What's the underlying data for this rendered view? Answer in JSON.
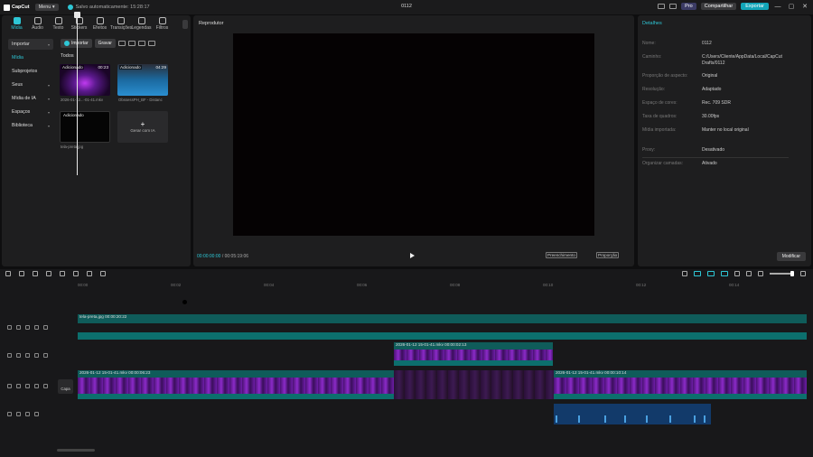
{
  "titlebar": {
    "app_name": "CapCut",
    "menu_label": "Menu",
    "autosave": "Salvo automaticamente: 15:28:17",
    "project_title": "0112",
    "pro_label": "Pro",
    "share_label": "Compartilhar",
    "export_label": "Exportar",
    "win_min": "—",
    "win_max": "▢",
    "win_close": "✕"
  },
  "tools": [
    {
      "label": "Mídia"
    },
    {
      "label": "Áudio"
    },
    {
      "label": "Texto"
    },
    {
      "label": "Stickers"
    },
    {
      "label": "Efeitos"
    },
    {
      "label": "Transições"
    },
    {
      "label": "Legendas"
    },
    {
      "label": "Filtros"
    }
  ],
  "sidenav": {
    "import": "Importar",
    "media": "Mídia",
    "subprojects": "Subprojetos",
    "yours": "Seus",
    "ai_media": "Mídia de IA",
    "spaces": "Espaços",
    "library": "Biblioteca"
  },
  "media": {
    "import_btn": "Importar",
    "record_btn": "Gravar",
    "all_label": "Todos",
    "items": [
      {
        "tag": "Adicionado",
        "duration": "00:23",
        "name": "2026-01-12...-01-41.mkv"
      },
      {
        "tag": "Adicionado",
        "duration": "04:29",
        "name": "ObssessPH_BF - Distanc"
      },
      {
        "tag": "Adicionado",
        "duration": "",
        "name": "tela-preta.jpg"
      },
      {
        "tag": "",
        "duration": "",
        "name": "Gerar com IA"
      }
    ]
  },
  "player": {
    "title": "Reprodutor",
    "current_time": "00:00:00:00",
    "total_time": "00:05:19:06",
    "fill_label": "Preenchimento",
    "ratio_label": "Proporção"
  },
  "details": {
    "title": "Detalhes",
    "rows": [
      {
        "k": "Nome:",
        "v": "0112"
      },
      {
        "k": "Caminho:",
        "v": "C:/Users/Cliente/AppData/Local/CapCut Drafts/0112"
      },
      {
        "k": "Proporção de aspecto:",
        "v": "Original"
      },
      {
        "k": "Resolução:",
        "v": "Adaptado"
      },
      {
        "k": "Espaço de cores:",
        "v": "Rec. 709 SDR"
      },
      {
        "k": "Taxa de quadros:",
        "v": "30.00fps"
      },
      {
        "k": "Mídia importada:",
        "v": "Manter no local original"
      },
      {
        "k": "Proxy:",
        "v": "Desativado"
      },
      {
        "k": "Organizar camadas:",
        "v": "Ativado"
      }
    ],
    "modify_btn": "Modificar"
  },
  "timeline": {
    "ruler": [
      "00:00",
      "00:02",
      "00:04",
      "00:06",
      "00:08",
      "00:10",
      "00:12",
      "00:14"
    ],
    "clips": {
      "image": "tela-preta.jpg   00:00:20:22",
      "overlay": "2026-01-12 15-01-41.mkv   00:00:02:13",
      "main1": "2026-01-12 15-01-41.mkv   00:00:06:23",
      "main2": "2026-01-12 15-01-41.mkv   00:00:10:14"
    },
    "cover_label": "Capa"
  }
}
